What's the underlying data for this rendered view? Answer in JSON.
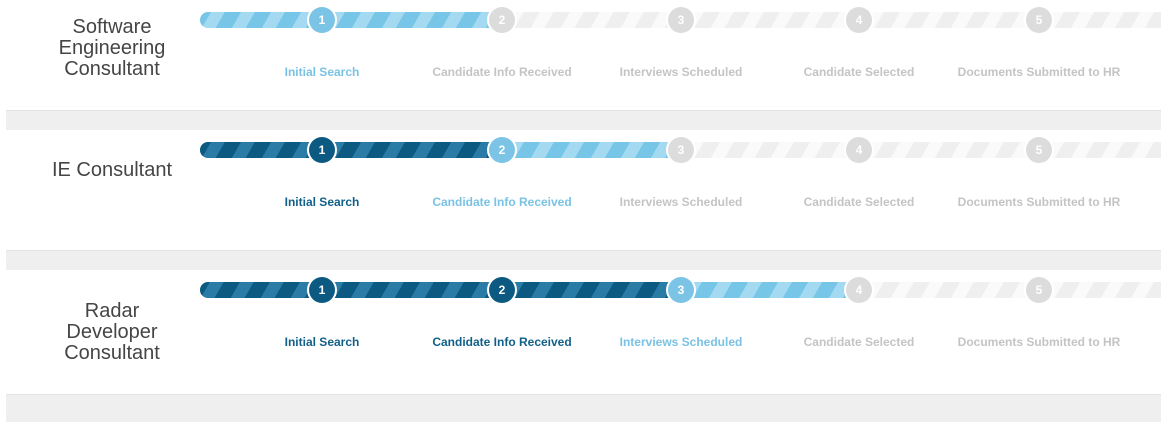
{
  "colors": {
    "done": "#0c5a81",
    "active": "#7cc4e6",
    "pending": "#dcdcdc"
  },
  "pipelines": [
    {
      "title": "Software Engineering Consultant",
      "title_lines": [
        "Software",
        "Engineering",
        "Consultant"
      ],
      "current_step": 1,
      "steps": [
        {
          "number": "1",
          "label": "Initial Search",
          "status": "active"
        },
        {
          "number": "2",
          "label": "Candidate Info Received",
          "status": "pending"
        },
        {
          "number": "3",
          "label": "Interviews Scheduled",
          "status": "pending"
        },
        {
          "number": "4",
          "label": "Candidate Selected",
          "status": "pending"
        },
        {
          "number": "5",
          "label": "Documents Submitted to HR",
          "status": "pending"
        }
      ]
    },
    {
      "title": "IE Consultant",
      "title_lines": [
        "IE Consultant"
      ],
      "current_step": 2,
      "steps": [
        {
          "number": "1",
          "label": "Initial Search",
          "status": "done"
        },
        {
          "number": "2",
          "label": "Candidate Info Received",
          "status": "active"
        },
        {
          "number": "3",
          "label": "Interviews Scheduled",
          "status": "pending"
        },
        {
          "number": "4",
          "label": "Candidate Selected",
          "status": "pending"
        },
        {
          "number": "5",
          "label": "Documents Submitted to HR",
          "status": "pending"
        }
      ]
    },
    {
      "title": "Radar Developer Consultant",
      "title_lines": [
        "Radar",
        "Developer",
        "Consultant"
      ],
      "current_step": 3,
      "steps": [
        {
          "number": "1",
          "label": "Initial Search",
          "status": "done"
        },
        {
          "number": "2",
          "label": "Candidate Info Received",
          "status": "done"
        },
        {
          "number": "3",
          "label": "Interviews Scheduled",
          "status": "active"
        },
        {
          "number": "4",
          "label": "Candidate Selected",
          "status": "pending"
        },
        {
          "number": "5",
          "label": "Documents Submitted to HR",
          "status": "pending"
        }
      ]
    }
  ]
}
